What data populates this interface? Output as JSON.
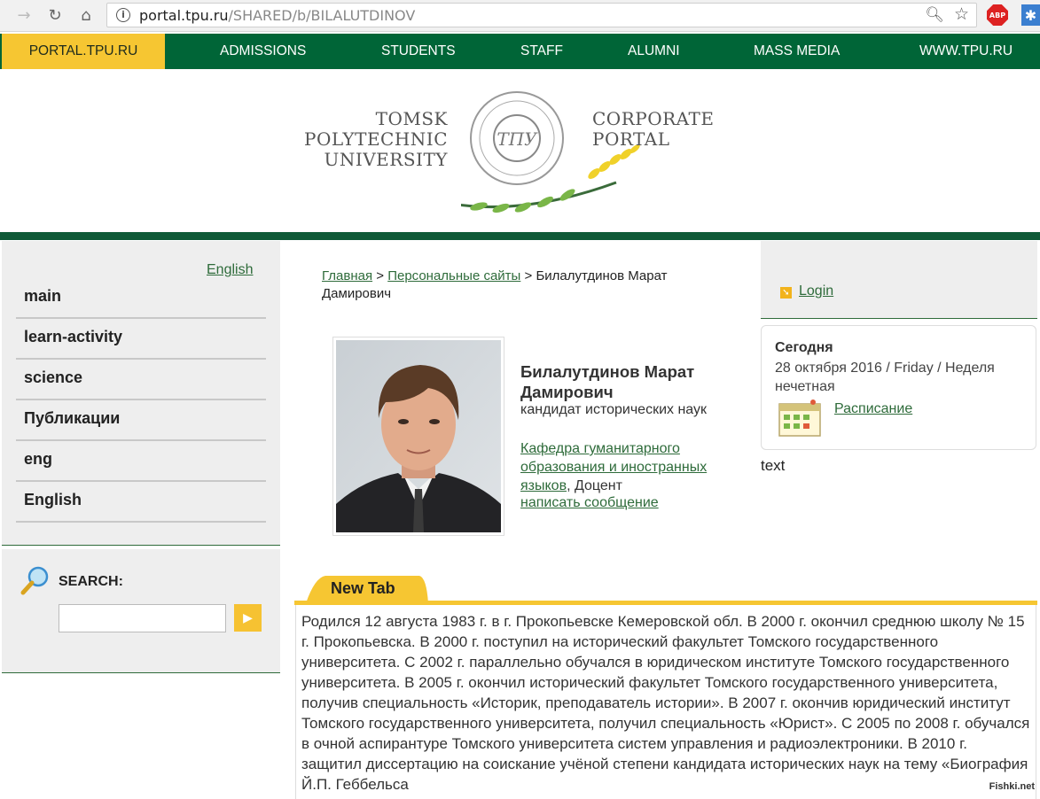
{
  "browser": {
    "url_host": "portal.tpu.ru",
    "url_path": "/SHARED/b/BILALUTDINOV",
    "abp_label": "ABP"
  },
  "topnav": {
    "items": [
      "PORTAL.TPU.RU",
      "ADMISSIONS",
      "STUDENTS",
      "STAFF",
      "ALUMNI",
      "MASS MEDIA",
      "WWW.TPU.RU"
    ]
  },
  "banner": {
    "left_line1": "TOMSK",
    "left_line2": "POLYTECHNIC",
    "left_line3": "UNIVERSITY",
    "right_line1": "CORPORATE",
    "right_line2": "PORTAL"
  },
  "sidebar": {
    "lang_link": "English",
    "menu": [
      "main",
      "learn-activity",
      "science",
      "Публикации",
      "eng",
      "English"
    ]
  },
  "search": {
    "label": "SEARCH:",
    "value": ""
  },
  "breadcrumb": {
    "home": "Главная",
    "sep1": " > ",
    "sites": "Персональные сайты",
    "sep2": " > ",
    "current": "Билалутдинов Марат Дамирович"
  },
  "profile": {
    "name_line1": "Билалутдинов Марат",
    "name_line2": "Дамирович",
    "degree": "кандидат исторических наук",
    "department": "Кафедра гуманитарного образования и иностранных языков",
    "position": ", Доцент",
    "message_link": "написать сообщение"
  },
  "right": {
    "login": "Login",
    "today_title": "Сегодня",
    "today_date": "28 октября 2016 / Friday / Неделя нечетная",
    "schedule_link": "Расписание",
    "extra_text": "text"
  },
  "tab": {
    "label": "New Tab"
  },
  "bio": {
    "text": "Родился 12 августа 1983 г. в г. Прокопьевске Кемеровской обл. В 2000 г. окончил среднюю школу № 15 г. Прокопьевска. В 2000 г. поступил на исторический факультет Томского государственного университета. С 2002 г. параллельно обучался в юридическом институте Томского государственного университета. В 2005 г. окончил исторический факультет Томского государственного университета, получив специальность «Историк, преподаватель истории». В 2007 г. окончив юридический институт Томского государственного университета, получил специальность «Юрист». С 2005 по 2008 г. обучался в очной аспирантуре Томского университета систем управления и радиоэлектроники. В 2010 г. защитил диссертацию на соискание учёной степени кандидата исторических наук на тему «Биография Й.П. Геббельса"
  },
  "watermark": "Fishki.net",
  "colors": {
    "nav_green": "#006537",
    "accent_yellow": "#f6c632",
    "link_green": "#2e6b3a"
  }
}
